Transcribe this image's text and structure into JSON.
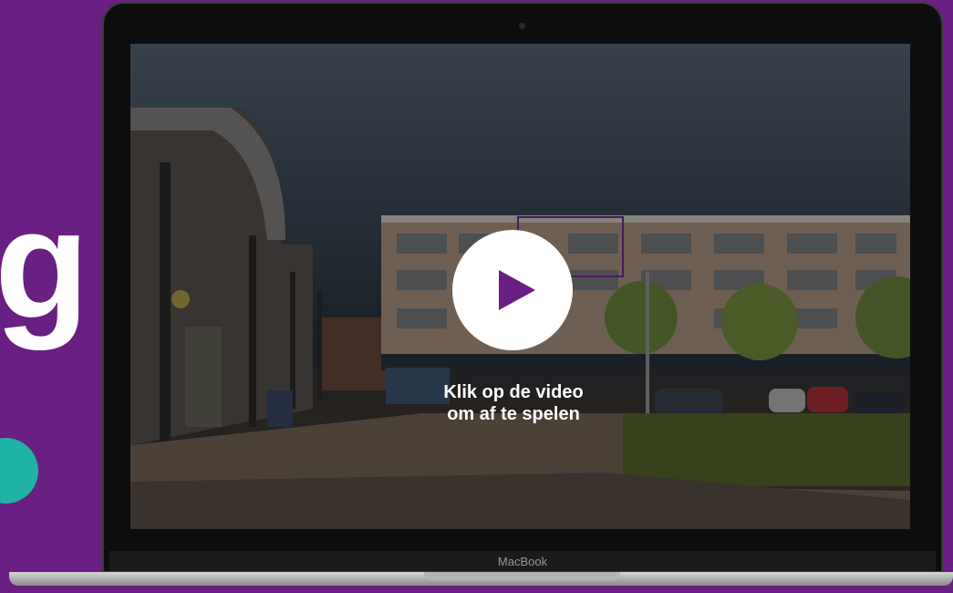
{
  "background": {
    "letter": "g",
    "color": "#6a1f82",
    "accent": "#1fb3a3"
  },
  "laptop": {
    "brand": "MacBook"
  },
  "video": {
    "caption_line1": "Klik op de video",
    "caption_line2": "om af te spelen",
    "play_icon": "play-icon",
    "play_color": "#6a1f82"
  }
}
